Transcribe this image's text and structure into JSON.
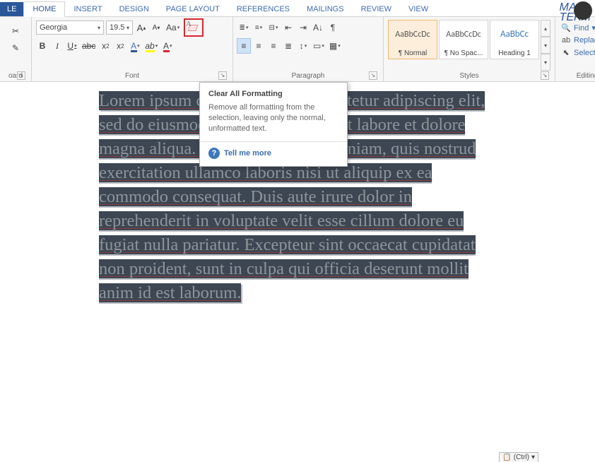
{
  "tabs": {
    "file": "LE",
    "items": [
      "HOME",
      "INSERT",
      "DESIGN",
      "PAGE LAYOUT",
      "REFERENCES",
      "MAILINGS",
      "REVIEW",
      "VIEW"
    ],
    "active_index": 0
  },
  "logo": {
    "line1": "MAS",
    "line2": "TEKM"
  },
  "ribbon": {
    "clipboard": {
      "label": "oard"
    },
    "font": {
      "label": "Font",
      "name": "Georgia",
      "size": "19.5",
      "grow": "A",
      "shrink": "A",
      "case": "Aa",
      "clear_alt": "Clear All Formatting",
      "bold": "B",
      "italic": "I",
      "underline": "U",
      "strike": "abc",
      "sub": "x",
      "sup": "x",
      "texteffect": "A",
      "highlight": "ab",
      "fontcolor": "A"
    },
    "paragraph": {
      "label": "Paragraph",
      "linespacing": "↕",
      "sort": "A↓",
      "pilcrow": "¶"
    },
    "styles": {
      "label": "Styles",
      "tiles": [
        {
          "preview": "AaBbCcDc",
          "name": "¶ Normal",
          "selected": true,
          "heading": false
        },
        {
          "preview": "AaBbCcDc",
          "name": "¶ No Spac...",
          "selected": false,
          "heading": false
        },
        {
          "preview": "AaBbCc",
          "name": "Heading 1",
          "selected": false,
          "heading": true
        }
      ]
    },
    "editing": {
      "label": "Editing",
      "find": "Find",
      "replace": "Replace",
      "select": "Select"
    }
  },
  "tooltip": {
    "title": "Clear All Formatting",
    "desc": "Remove all formatting from the selection, leaving only the normal, unformatted text.",
    "link": "Tell me more"
  },
  "document": {
    "text": "Lorem ipsum dolor sit amet, consectetur adipiscing elit, sed do eiusmod tempor incididunt ut labore et dolore magna aliqua. Ut enim ad minim veniam, quis nostrud exercitation ullamco laboris nisi ut aliquip ex ea commodo consequat. Duis aute irure dolor in reprehenderit in voluptate velit esse cillum dolore eu fugiat nulla pariatur. Excepteur sint occaecat cupidatat non proident, sunt in culpa qui officia deserunt mollit anim id est laborum."
  },
  "paste_badge": {
    "label": "(Ctrl)"
  }
}
